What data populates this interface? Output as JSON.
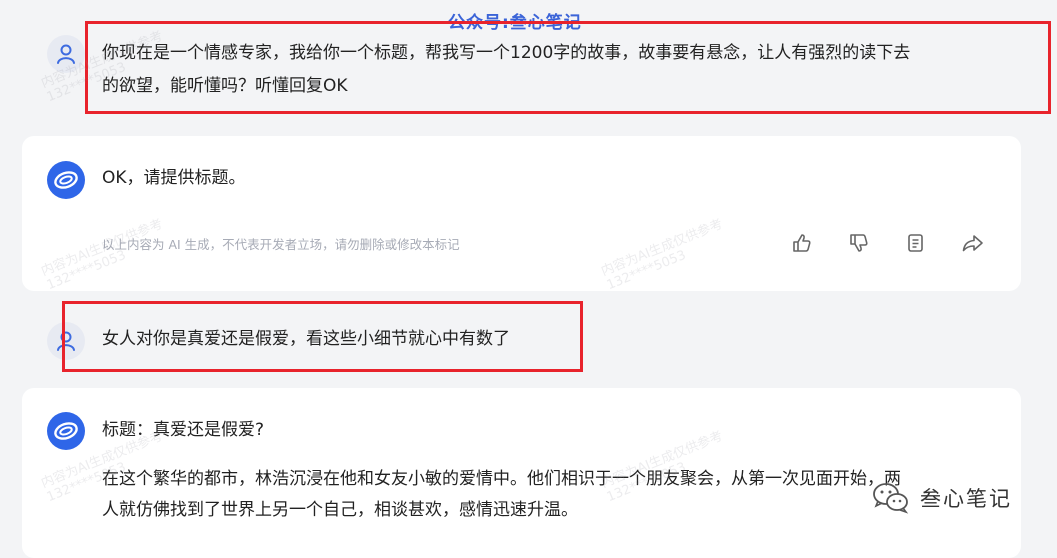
{
  "watermark_top": "公众号:叁心笔记",
  "watermark_brand": "叁心笔记",
  "faint_watermark": {
    "line1": "内容为AI生成仅供参考",
    "line2": "132****5053"
  },
  "icons": {
    "user_avatar": "user-icon",
    "ai_avatar": "ai-logo-icon",
    "actions": [
      "thumbs-up-icon",
      "thumbs-down-icon",
      "copy-icon",
      "share-icon"
    ],
    "brand": "wechat-icon"
  },
  "colors": {
    "highlight_box": "#e8232c",
    "ai_avatar": "#2f66e8",
    "background": "#f3f4f6"
  },
  "messages": [
    {
      "role": "user",
      "lines": [
        "你现在是一个情感专家，我给你一个标题，帮我写一个1200字的故事，故事要有悬念，让人有强烈的读下去",
        "的欲望，能听懂吗？听懂回复OK"
      ]
    },
    {
      "role": "ai",
      "text": "OK，请提供标题。",
      "disclaimer": "以上内容为 AI 生成，不代表开发者立场，请勿删除或修改本标记"
    },
    {
      "role": "user",
      "text": "女人对你是真爱还是假爱，看这些小细节就心中有数了"
    },
    {
      "role": "ai",
      "title": "标题：真爱还是假爱?",
      "lines": [
        "在这个繁华的都市，林浩沉浸在他和女友小敏的爱情中。他们相识于一个朋友聚会，从第一次见面开始，两",
        "人就仿佛找到了世界上另一个自己，相谈甚欢，感情迅速升温。"
      ]
    }
  ]
}
